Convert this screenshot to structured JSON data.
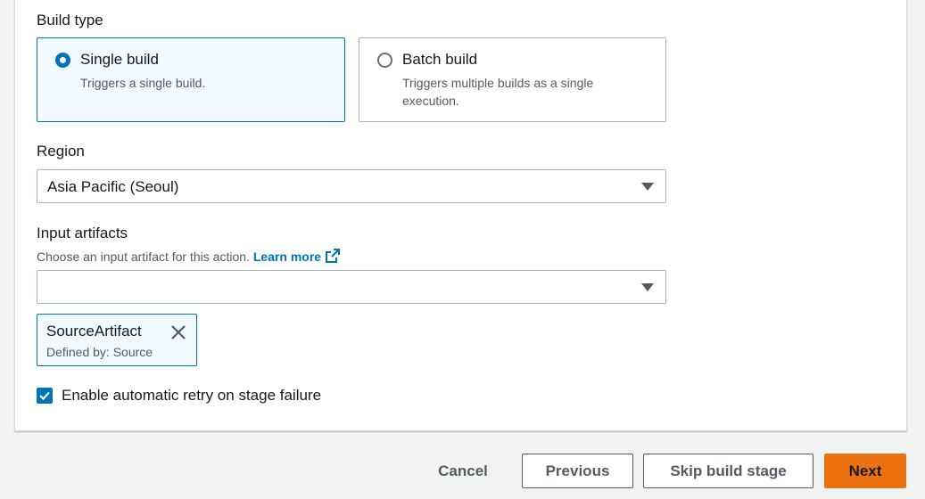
{
  "build_type": {
    "label": "Build type",
    "options": [
      {
        "title": "Single build",
        "description": "Triggers a single build.",
        "selected": true
      },
      {
        "title": "Batch build",
        "description": "Triggers multiple builds as a single execution.",
        "selected": false
      }
    ]
  },
  "region": {
    "label": "Region",
    "value": "Asia Pacific (Seoul)"
  },
  "input_artifacts": {
    "label": "Input artifacts",
    "description": "Choose an input artifact for this action.",
    "learn_more": "Learn more",
    "select_value": "",
    "selected_token": {
      "name": "SourceArtifact",
      "subtitle": "Defined by: Source"
    }
  },
  "retry": {
    "label": "Enable automatic retry on stage failure",
    "checked": true
  },
  "footer": {
    "cancel": "Cancel",
    "previous": "Previous",
    "skip": "Skip build stage",
    "next": "Next"
  },
  "colors": {
    "accent": "#0073bb",
    "primary_button": "#ec7211"
  }
}
